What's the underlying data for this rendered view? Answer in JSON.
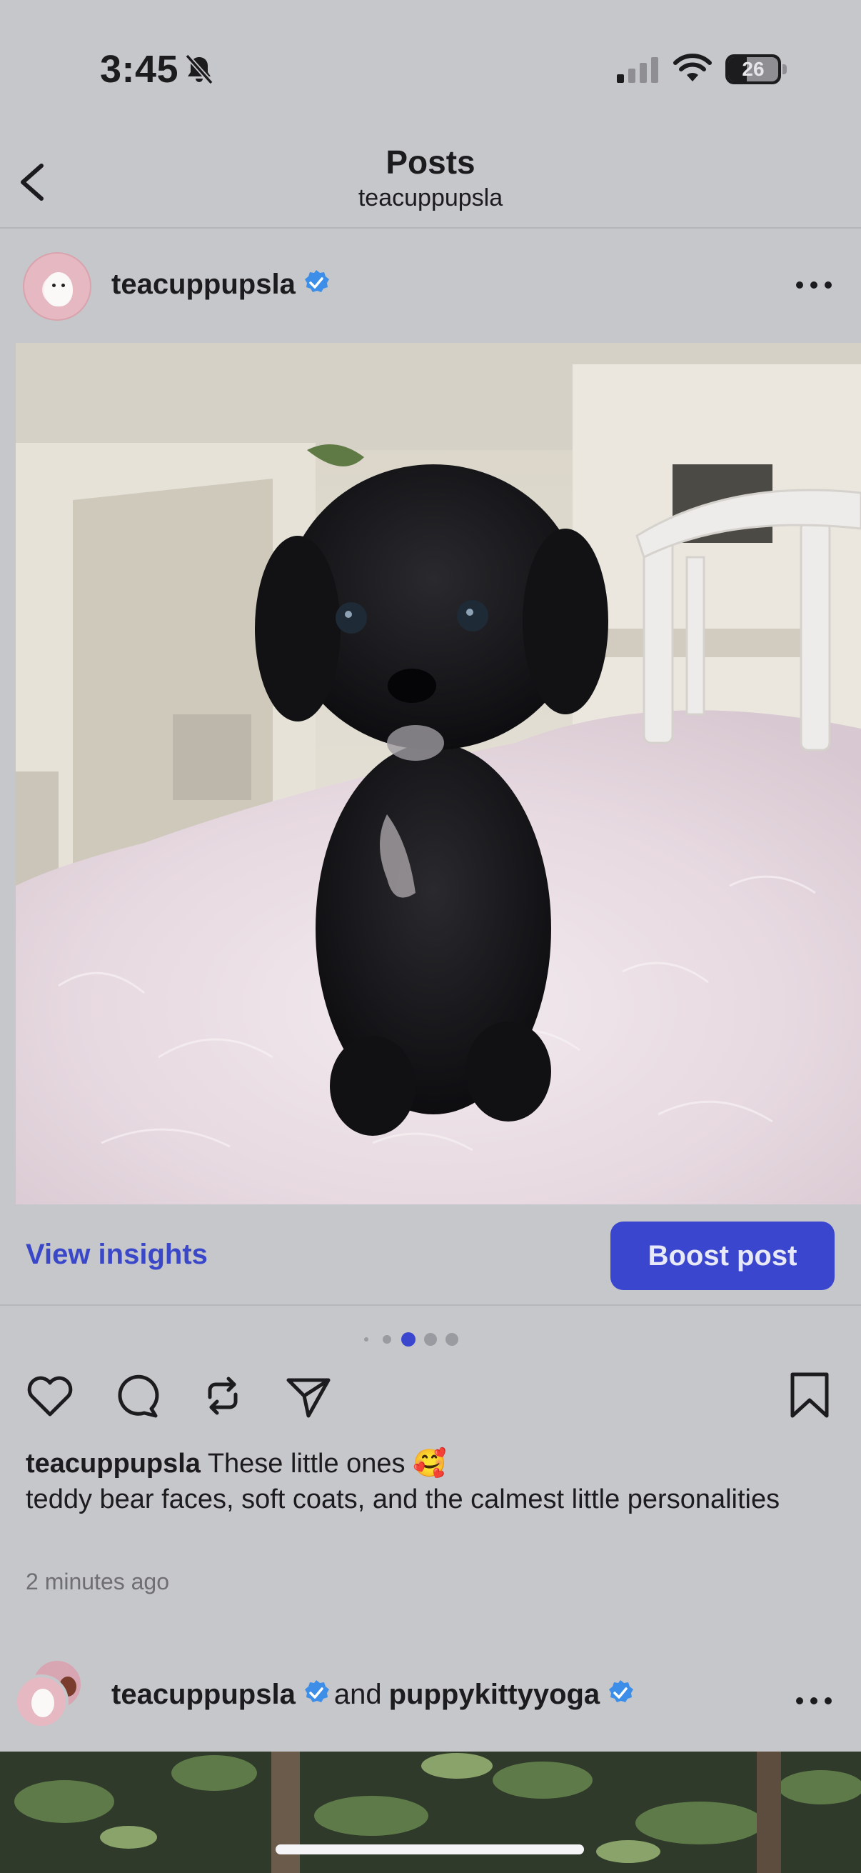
{
  "status_bar": {
    "time": "3:45",
    "battery_level": "26",
    "icons": [
      "bell-slash-icon",
      "cellular-signal-icon",
      "wifi-icon",
      "battery-icon"
    ]
  },
  "nav": {
    "title": "Posts",
    "subtitle": "teacuppupsla",
    "back_icon": "chevron-left-icon"
  },
  "post": {
    "username": "teacuppupsla",
    "verified": true,
    "more_icon": "ellipsis-icon",
    "image_icon": "photo-black-puppy-on-pink-fur-rug",
    "view_insights_label": "View insights",
    "boost_label": "Boost post",
    "carousel": {
      "total_dots": 5,
      "active_index": 2
    },
    "actions": [
      "heart-icon",
      "comment-icon",
      "repost-icon",
      "share-icon",
      "bookmark-icon"
    ],
    "caption_user": "teacuppupsla",
    "caption_text": " These little ones 🥰",
    "caption_line2": "teddy bear faces, soft coats, and the calmest little personalities",
    "timestamp": "2 minutes ago"
  },
  "next_post": {
    "user1": "teacuppupsla",
    "joiner": "and",
    "user2": "puppykittyyoga",
    "more_icon": "ellipsis-icon"
  },
  "colors": {
    "background": "#c6c7cb",
    "accent_blue": "#3b46cf",
    "link_blue": "#3a47c8",
    "verified_blue": "#3d8ee8"
  }
}
